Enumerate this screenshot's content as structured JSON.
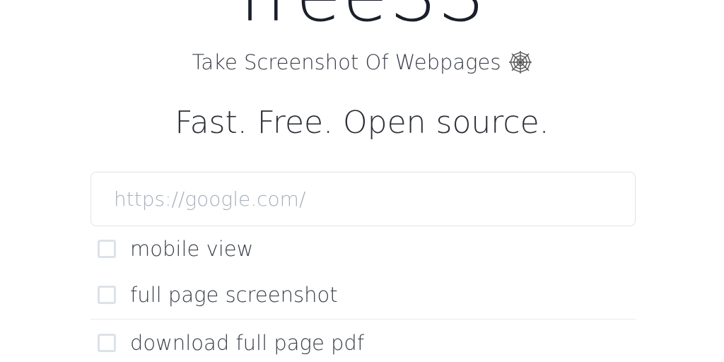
{
  "logo": {
    "text": "freeSS"
  },
  "tagline": {
    "text": "Take Screenshot Of Webpages",
    "icon": "spider-web-icon"
  },
  "headline": {
    "text": "Fast. Free. Open source."
  },
  "url_input": {
    "placeholder": "https://google.com/",
    "value": ""
  },
  "options": [
    {
      "label": "mobile view",
      "checked": false
    },
    {
      "label": "full page screenshot",
      "checked": false
    },
    {
      "label": "download full page pdf",
      "checked": false
    }
  ],
  "colors": {
    "text": "#1e2430",
    "muted_text": "#3a3f48",
    "placeholder": "#a9b0bb",
    "border": "#dfe3e8"
  }
}
